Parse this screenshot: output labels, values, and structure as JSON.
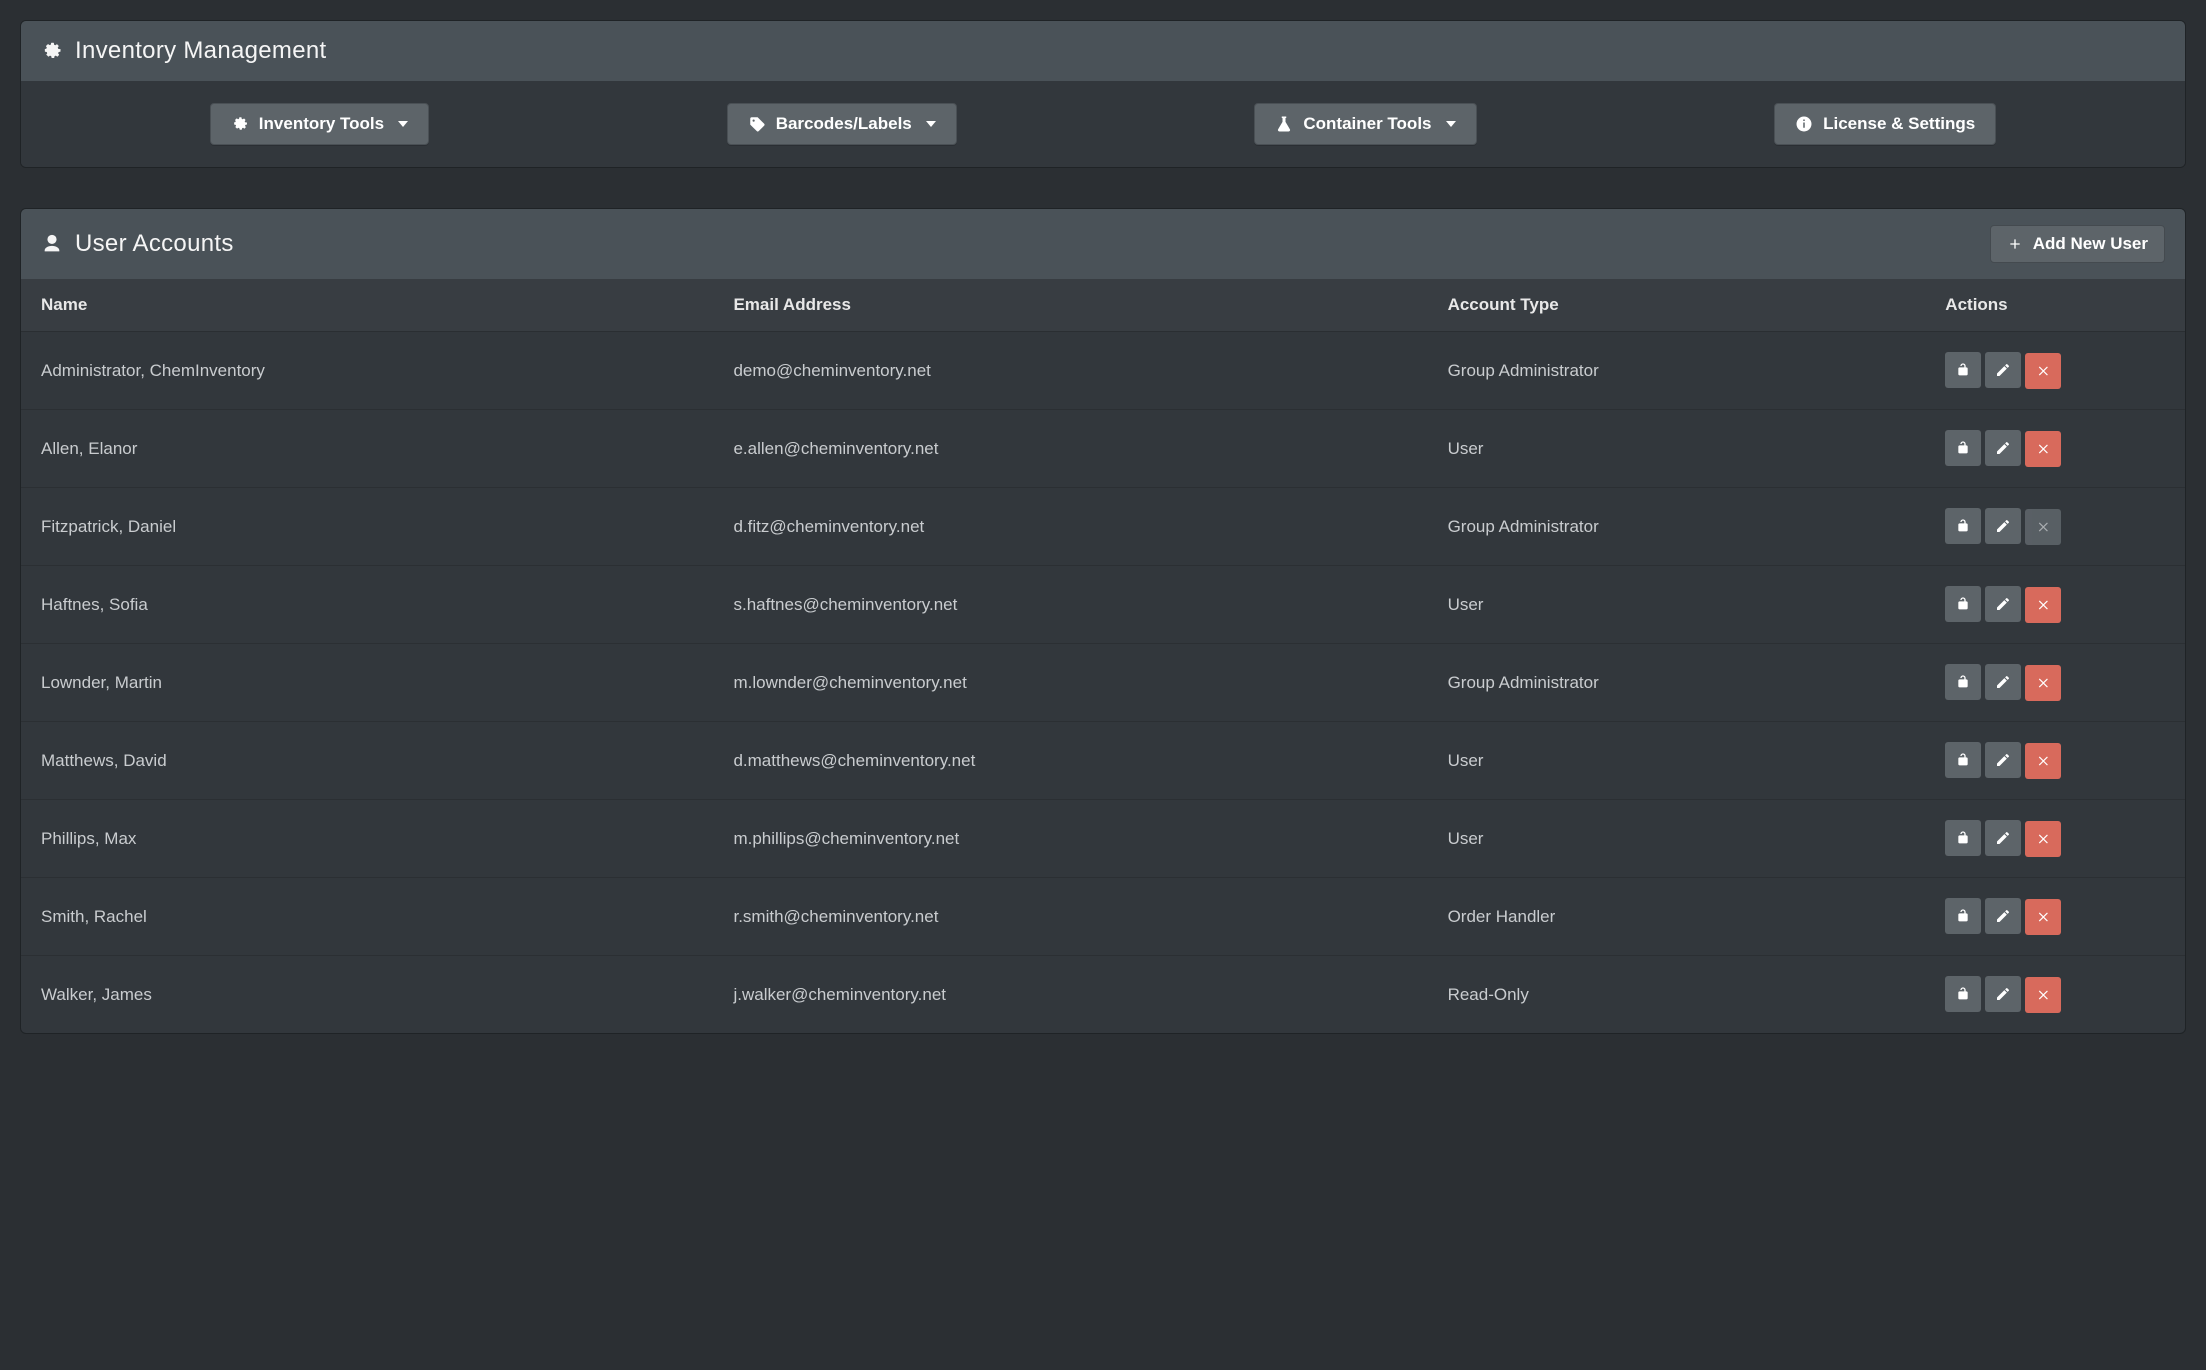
{
  "panels": {
    "inventory": {
      "title": "Inventory Management"
    },
    "users": {
      "title": "User Accounts",
      "add_button": "Add New User"
    }
  },
  "toolbar": {
    "inventory_tools": "Inventory Tools",
    "barcodes_labels": "Barcodes/Labels",
    "container_tools": "Container Tools",
    "license_settings": "License & Settings"
  },
  "columns": {
    "name": "Name",
    "email": "Email Address",
    "type": "Account Type",
    "actions": "Actions"
  },
  "users": [
    {
      "name": "Administrator, ChemInventory",
      "email": "demo@cheminventory.net",
      "type": "Group Administrator",
      "can_delete": true
    },
    {
      "name": "Allen, Elanor",
      "email": "e.allen@cheminventory.net",
      "type": "User",
      "can_delete": true
    },
    {
      "name": "Fitzpatrick, Daniel",
      "email": "d.fitz@cheminventory.net",
      "type": "Group Administrator",
      "can_delete": false
    },
    {
      "name": "Haftnes, Sofia",
      "email": "s.haftnes@cheminventory.net",
      "type": "User",
      "can_delete": true
    },
    {
      "name": "Lownder, Martin",
      "email": "m.lownder@cheminventory.net",
      "type": "Group Administrator",
      "can_delete": true
    },
    {
      "name": "Matthews, David",
      "email": "d.matthews@cheminventory.net",
      "type": "User",
      "can_delete": true
    },
    {
      "name": "Phillips, Max",
      "email": "m.phillips@cheminventory.net",
      "type": "User",
      "can_delete": true
    },
    {
      "name": "Smith, Rachel",
      "email": "r.smith@cheminventory.net",
      "type": "Order Handler",
      "can_delete": true
    },
    {
      "name": "Walker, James",
      "email": "j.walker@cheminventory.net",
      "type": "Read-Only",
      "can_delete": true
    }
  ]
}
